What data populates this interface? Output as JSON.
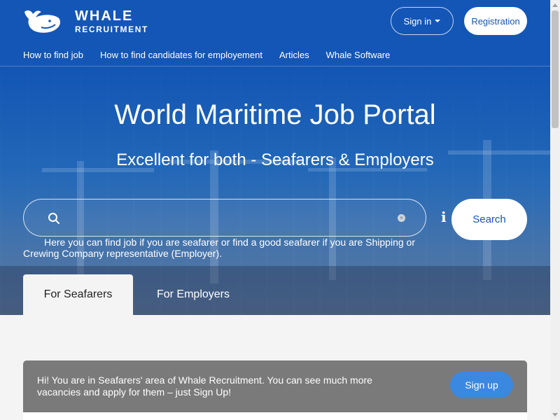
{
  "brand": {
    "title": "WHALE",
    "subtitle": "RECRUITMENT"
  },
  "header": {
    "signin_label": "Sign in",
    "register_label": "Registration",
    "nav": [
      "How to find job",
      "How to find candidates for employement",
      "Articles",
      "Whale Software"
    ]
  },
  "hero": {
    "title": "World Maritime Job Portal",
    "subtitle": "Excellent for both - Seafarers & Employers",
    "search_value": "",
    "search_button": "Search",
    "hint": "Here you can find job if you are seafarer or find a good seafarer if you are Shipping or Crewing Company representative (Employer)."
  },
  "tabs": [
    "For Seafarers",
    "For Employers"
  ],
  "notice": {
    "text": "Hi! You are in Seafarers' area of Whale Recruitment. You can see much more vacancies and apply for them – just Sign Up!",
    "button": "Sign up"
  },
  "colors": {
    "header_blue": "#1456b6",
    "accent": "#3b88e0",
    "notice_bg": "#7a7a7a"
  },
  "icons": {
    "logo": "whale-icon",
    "search": "search-icon",
    "clear": "clear-icon",
    "info": "info-icon",
    "caret": "caret-down-icon"
  }
}
